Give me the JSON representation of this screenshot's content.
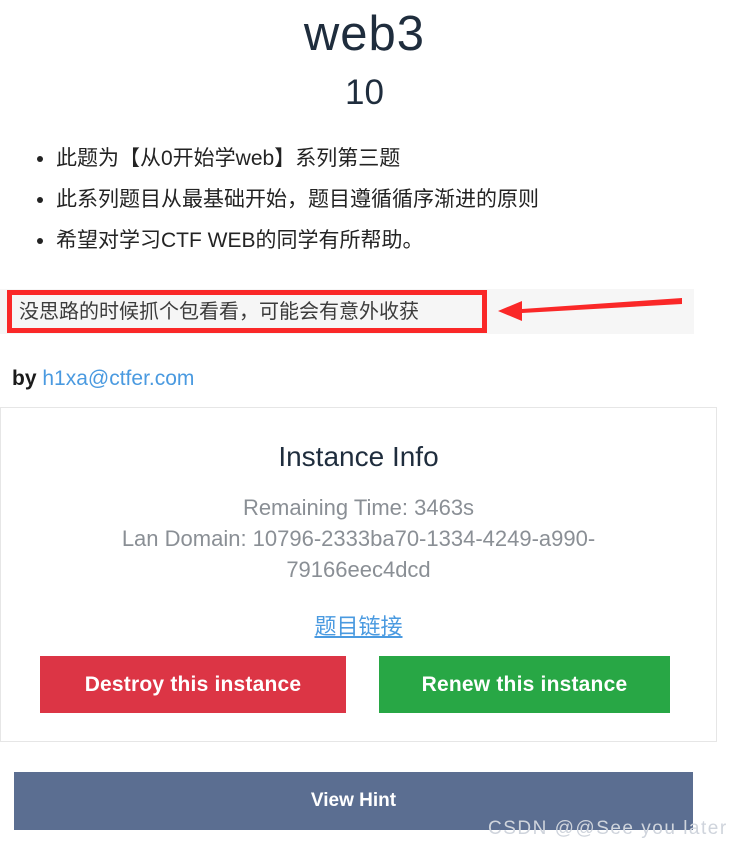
{
  "header": {
    "title": "web3",
    "points": "10"
  },
  "description": {
    "items": [
      "此题为【从0开始学web】系列第三题",
      "此系列题目从最基础开始，题目遵循循序渐进的原则",
      "希望对学习CTF WEB的同学有所帮助。"
    ]
  },
  "hint": {
    "text": "没思路的时候抓个包看看，可能会有意外收获",
    "annotation_color": "#fa2828",
    "strip_background": "#f6f6f6"
  },
  "author": {
    "prefix": "by",
    "email": "h1xa@ctfer.com"
  },
  "instance": {
    "heading": "Instance Info",
    "remaining_time": "Remaining Time: 3463s",
    "lan_domain": "Lan Domain: 10796-2333ba70-1334-4249-a990-79166eec4dcd",
    "link_label": "题目链接",
    "destroy_label": "Destroy this instance",
    "renew_label": "Renew this instance",
    "destroy_color": "#dc3545",
    "renew_color": "#28a745"
  },
  "footer": {
    "view_hint_label": "View Hint",
    "view_hint_color": "#5b6e91",
    "watermark": "CSDN @@See you  later"
  }
}
